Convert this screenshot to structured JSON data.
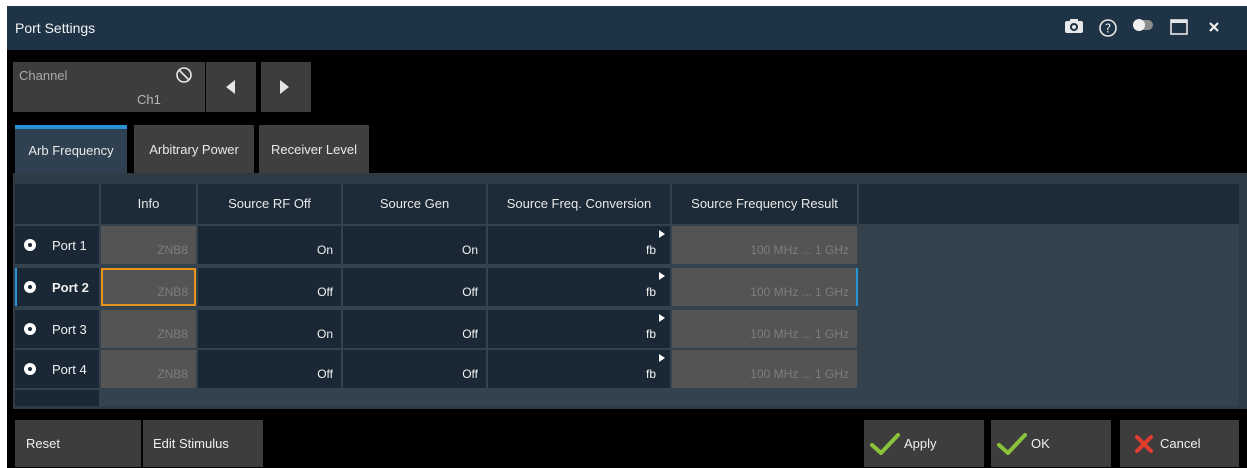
{
  "window": {
    "title": "Port Settings",
    "icons": [
      "camera-icon",
      "help-icon",
      "toggle-icon",
      "maximize-icon",
      "close-icon"
    ]
  },
  "channel": {
    "label": "Channel",
    "value": "Ch1"
  },
  "tabs": [
    "Arb Frequency",
    "Arbitrary Power",
    "Receiver Level"
  ],
  "active_tab": "Arb Frequency",
  "table": {
    "headers": [
      "Info",
      "Source RF Off",
      "Source Gen",
      "Source Freq. Conversion",
      "Source Frequency Result"
    ],
    "rows": [
      {
        "port": "Port 1",
        "info": "ZNB8",
        "rf_off": "On",
        "gen": "On",
        "conv": "fb",
        "result": "100 MHz ... 1 GHz"
      },
      {
        "port": "Port 2",
        "info": "ZNB8",
        "rf_off": "Off",
        "gen": "Off",
        "conv": "fb",
        "result": "100 MHz ... 1 GHz"
      },
      {
        "port": "Port 3",
        "info": "ZNB8",
        "rf_off": "On",
        "gen": "Off",
        "conv": "fb",
        "result": "100 MHz ... 1 GHz"
      },
      {
        "port": "Port 4",
        "info": "ZNB8",
        "rf_off": "Off",
        "gen": "Off",
        "conv": "fb",
        "result": "100 MHz ... 1 GHz"
      }
    ],
    "selected_row": "Port 2"
  },
  "buttons": {
    "reset": "Reset",
    "edit_stimulus": "Edit Stimulus",
    "apply": "Apply",
    "ok": "OK",
    "cancel": "Cancel"
  },
  "colors": {
    "titlebar": "#1e3446",
    "accent": "#2a93d5",
    "selection": "#e8931e",
    "check": "#8bc23c",
    "cancel_x": "#e23b2e"
  }
}
